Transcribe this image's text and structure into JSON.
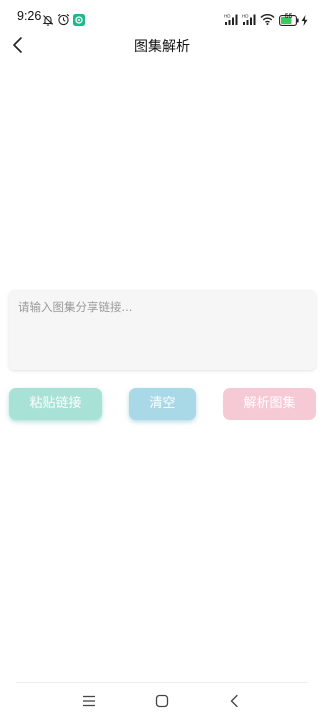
{
  "status_bar": {
    "time": "9:26",
    "icons": [
      "bell-muted-icon",
      "alarm-icon",
      "app-notification-icon",
      "signal-hd-icon",
      "signal-hd-icon",
      "wifi-icon",
      "battery-icon",
      "charging-icon"
    ],
    "battery_level": "66"
  },
  "header": {
    "title": "图集解析",
    "back_icon": "chevron-left-icon"
  },
  "input": {
    "placeholder": "请输入图集分享链接...",
    "value": ""
  },
  "actions": {
    "paste_label": "粘贴链接",
    "clear_label": "清空",
    "parse_label": "解析图集"
  },
  "colors": {
    "paste_button": "#a8e2d6",
    "clear_button": "#a9d9e6",
    "parse_button": "#f6cad4",
    "input_background": "#f6f6f6"
  },
  "nav_bar": {
    "icons": [
      "menu-icon",
      "home-icon",
      "back-icon"
    ]
  }
}
